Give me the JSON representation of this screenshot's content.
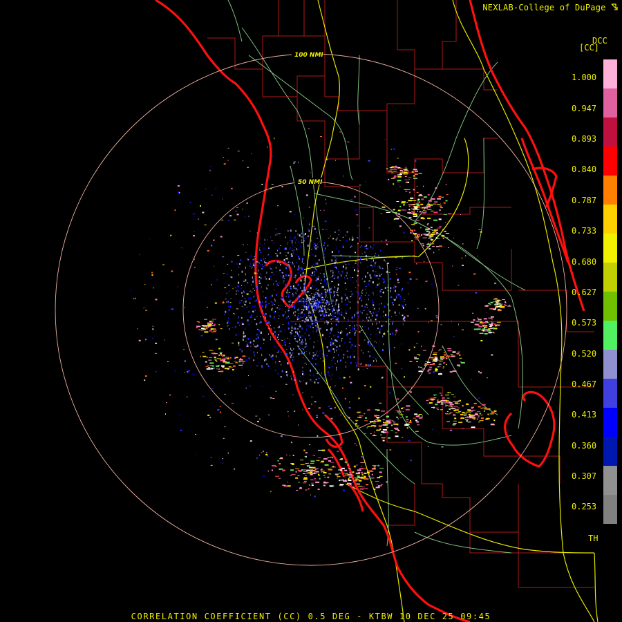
{
  "app": {
    "credit": "NEXLAB-College of DuPage",
    "credit_icon": "corner-arrow-icon",
    "footer_title": "CORRELATION COEFFICIENT (CC) 0.5 DEG - KTBW 10 DEC 25 09:45"
  },
  "legend": {
    "title": "DCC",
    "unit": "[CC]",
    "labels": [
      "1.000",
      "0.947",
      "0.893",
      "0.840",
      "0.787",
      "0.733",
      "0.680",
      "0.627",
      "0.573",
      "0.520",
      "0.467",
      "0.413",
      "0.360",
      "0.307",
      "0.253"
    ],
    "threshold_label": "TH",
    "colors": [
      "#ffb0d8",
      "#e060a0",
      "#c01040",
      "#ff0000",
      "#ff8000",
      "#ffd000",
      "#f0f000",
      "#c0d000",
      "#70c000",
      "#50f060",
      "#9090d0",
      "#4040e0",
      "#0000ff",
      "#0018b0",
      "#909090",
      "#808080",
      "#000000"
    ]
  },
  "rings": [
    {
      "label": "50 NMI"
    },
    {
      "label": "100 NMI"
    }
  ],
  "colors": {
    "background": "#000000",
    "county_lines": "#b01818",
    "coastline": "#ff1010",
    "highways": "#f0f000",
    "roads": "#80c080",
    "range_rings": "#f0b0a0",
    "text": "#f0f000"
  }
}
